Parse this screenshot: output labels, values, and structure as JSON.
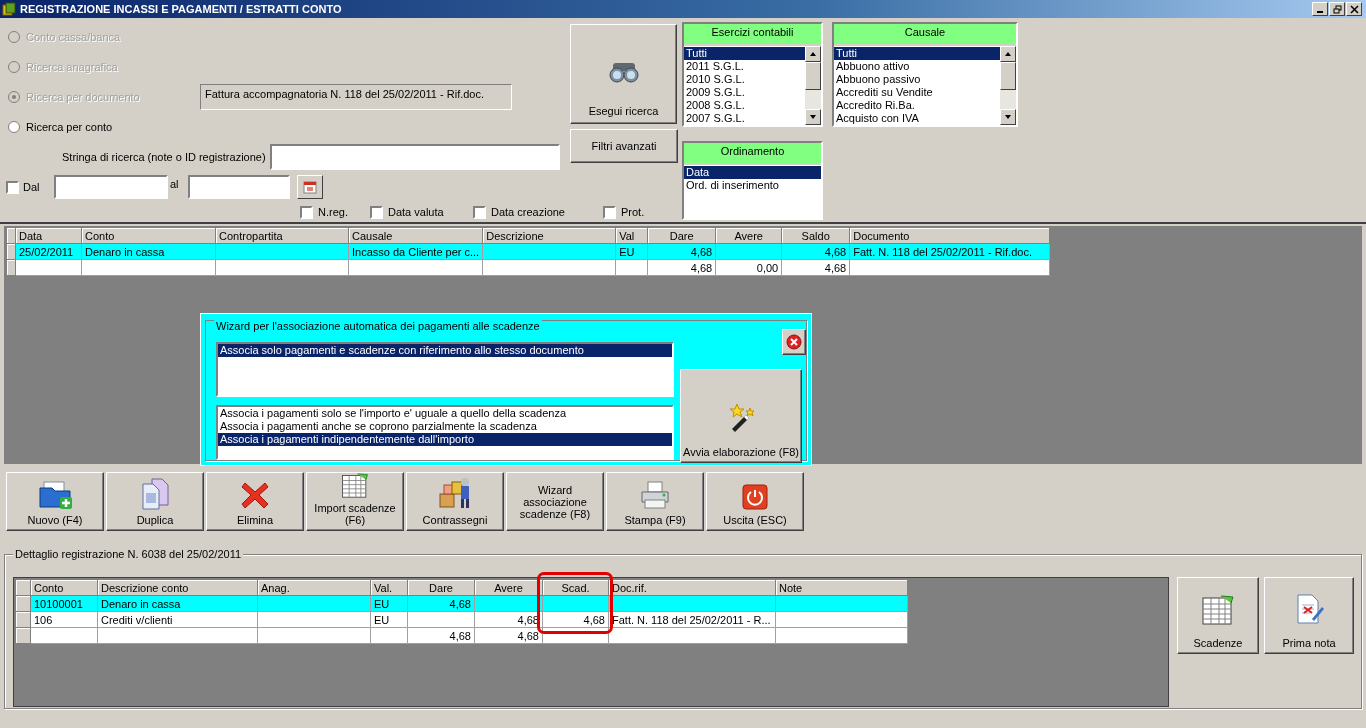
{
  "window": {
    "title": "REGISTRAZIONE INCASSI E PAGAMENTI / ESTRATTI CONTO"
  },
  "search_modes": [
    {
      "label": "Conto cassa/banca",
      "selected": false,
      "disabled": true
    },
    {
      "label": "Ricerca anagrafica",
      "selected": false,
      "disabled": true
    },
    {
      "label": "Ricerca per documento",
      "selected": true,
      "disabled": true,
      "value": "Fattura accompagnatoria N. 118 del 25/02/2011 - Rif.doc."
    },
    {
      "label": "Ricerca per conto",
      "selected": false,
      "disabled": false
    }
  ],
  "search_string": {
    "label": "Stringa di ricerca (note o ID registrazione)"
  },
  "date_range": {
    "checked": false,
    "from_label": "Dal",
    "to_label": "al"
  },
  "date_options": [
    {
      "label": "N.reg.",
      "checked": false
    },
    {
      "label": "Data valuta",
      "checked": false
    },
    {
      "label": "Data creazione",
      "checked": false
    },
    {
      "label": "Prot.",
      "checked": false
    }
  ],
  "search_button": "Esegui ricerca",
  "filters_button": "Filtri avanzati",
  "lists": [
    {
      "title": "Esercizi contabili",
      "scrollable": true,
      "items": [
        {
          "label": "Tutti",
          "selected": true
        },
        {
          "label": "2011 S.G.L.",
          "selected": false
        },
        {
          "label": "2010 S.G.L.",
          "selected": false
        },
        {
          "label": "2009 S.G.L.",
          "selected": false
        },
        {
          "label": "2008 S.G.L.",
          "selected": false
        },
        {
          "label": "2007 S.G.L.",
          "selected": false
        }
      ]
    },
    {
      "title": "Causale",
      "scrollable": true,
      "items": [
        {
          "label": "Tutti",
          "selected": true
        },
        {
          "label": "Abbuono attivo",
          "selected": false
        },
        {
          "label": "Abbuono passivo",
          "selected": false
        },
        {
          "label": "Accrediti su Vendite",
          "selected": false
        },
        {
          "label": "Accredito Ri.Ba.",
          "selected": false
        },
        {
          "label": "Acquisto con IVA",
          "selected": false
        }
      ]
    },
    {
      "title": "Ordinamento",
      "scrollable": false,
      "items": [
        {
          "label": "Data",
          "selected": true
        },
        {
          "label": "Ord. di inserimento",
          "selected": false
        }
      ]
    }
  ],
  "entries_table": {
    "columns": [
      {
        "label": "Data",
        "numeric": false
      },
      {
        "label": "Conto",
        "numeric": false
      },
      {
        "label": "Contropartita",
        "numeric": false
      },
      {
        "label": "Causale",
        "numeric": false
      },
      {
        "label": "Descrizione",
        "numeric": false
      },
      {
        "label": "Val",
        "numeric": false
      },
      {
        "label": "Dare",
        "numeric": true
      },
      {
        "label": "Avere",
        "numeric": true
      },
      {
        "label": "Saldo",
        "numeric": true
      },
      {
        "label": "Documento",
        "numeric": false
      }
    ],
    "rows": [
      {
        "selected": true,
        "cells": [
          "25/02/2011",
          "Denaro in cassa",
          null,
          "Incasso da Cliente per c...",
          null,
          "EU",
          "4,68",
          null,
          "4,68",
          "Fatt. N. 118 del 25/02/2011 - Rif.doc."
        ]
      },
      {
        "selected": false,
        "cells": [
          null,
          null,
          null,
          null,
          null,
          null,
          "4,68",
          "0,00",
          "4,68",
          null
        ]
      }
    ]
  },
  "wizard": {
    "title": "Wizard per l'associazione automatica dei pagamenti alle scadenze",
    "scope_options": [
      {
        "label": "Associa solo pagamenti e scadenze con riferimento allo stesso documento",
        "selected": true
      }
    ],
    "amount_options": [
      {
        "label": "Associa i pagamenti solo se l'importo e' uguale a quello della scadenza",
        "selected": false
      },
      {
        "label": "Associa i pagamenti anche se coprono parzialmente la scadenza",
        "selected": false
      },
      {
        "label": "Associa i pagamenti indipendentemente dall'importo",
        "selected": true
      }
    ],
    "run_button": "Avvia elaborazione (F8)"
  },
  "toolbar": [
    "Nuovo (F4)",
    "Duplica",
    "Elimina",
    "Import scadenze (F6)",
    "Contrassegni",
    "Wizard associazione scadenze (F8)",
    "Stampa (F9)",
    "Uscita (ESC)"
  ],
  "detail": {
    "title": "Dettaglio registrazione N. 6038 del 25/02/2011",
    "columns": [
      {
        "label": "Conto",
        "numeric": false,
        "highlighted": false
      },
      {
        "label": "Descrizione conto",
        "numeric": false,
        "highlighted": false
      },
      {
        "label": "Anag.",
        "numeric": false,
        "highlighted": false
      },
      {
        "label": "Val.",
        "numeric": false,
        "highlighted": false
      },
      {
        "label": "Dare",
        "numeric": true,
        "highlighted": false
      },
      {
        "label": "Avere",
        "numeric": true,
        "highlighted": false
      },
      {
        "label": "Scad.",
        "numeric": true,
        "highlighted": true
      },
      {
        "label": "Doc.rif.",
        "numeric": false,
        "highlighted": false
      },
      {
        "label": "Note",
        "numeric": false,
        "highlighted": false
      }
    ],
    "rows": [
      {
        "selected": true,
        "cells": [
          "10100001",
          "Denaro in cassa",
          null,
          "EU",
          "4,68",
          null,
          null,
          null,
          null
        ]
      },
      {
        "selected": false,
        "cells": [
          "106",
          "Crediti v/clienti",
          null,
          "EU",
          null,
          "4,68",
          "4,68",
          "Fatt. N. 118 del 25/02/2011 - R...",
          null
        ]
      },
      {
        "selected": false,
        "cells": [
          null,
          null,
          null,
          null,
          "4,68",
          "4,68",
          null,
          null,
          null
        ]
      }
    ],
    "buttons": [
      "Scadenze",
      "Prima nota"
    ]
  }
}
